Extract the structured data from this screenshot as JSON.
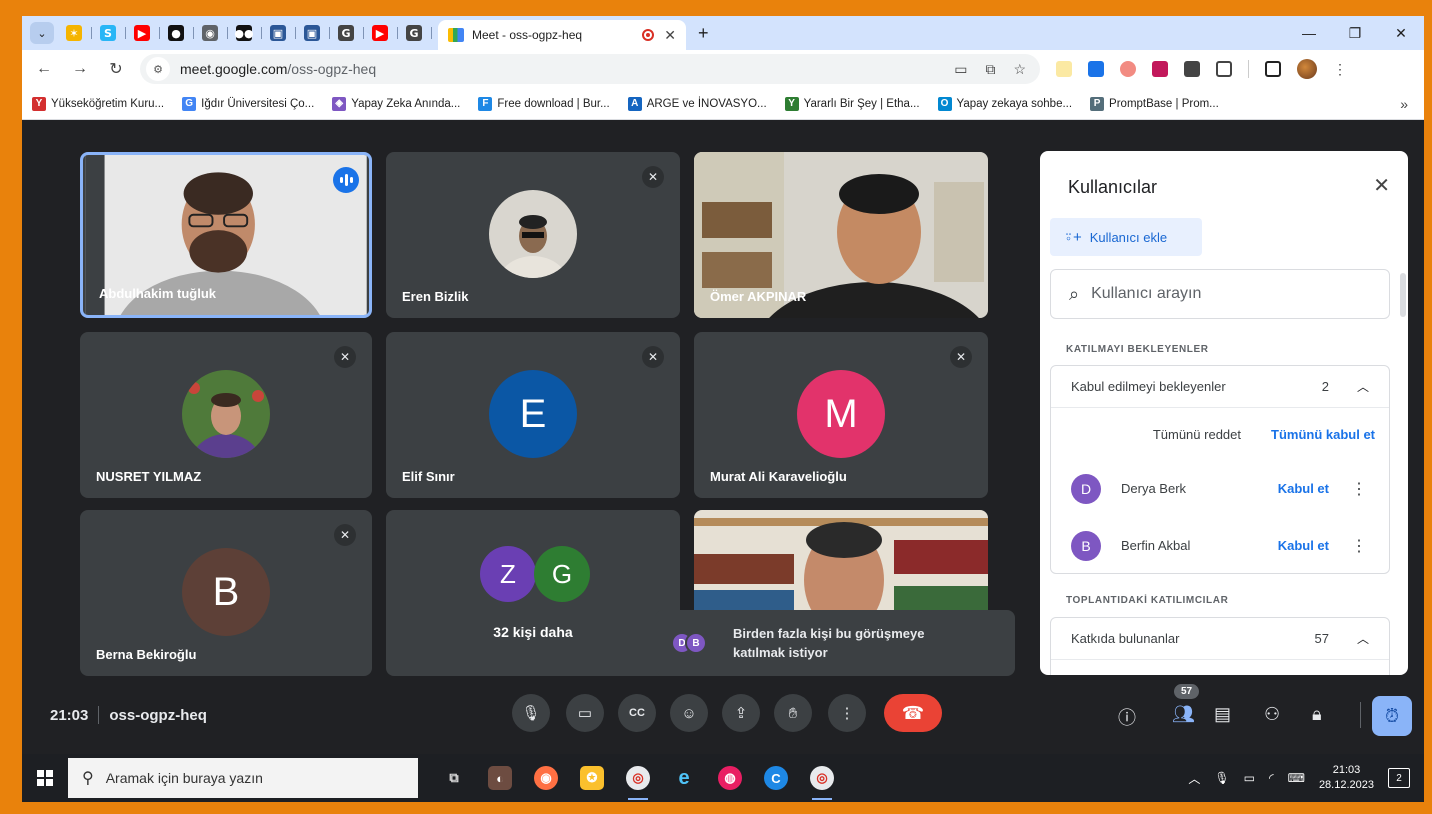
{
  "browser": {
    "pinned_tabs": [
      {
        "icon": "yellow-star-icon",
        "color": "#f5b400",
        "glyph": "✶"
      },
      {
        "icon": "s-icon",
        "color": "#29b6f6",
        "glyph": "S"
      },
      {
        "icon": "youtube-icon",
        "color": "#ff0000",
        "glyph": "▶"
      },
      {
        "icon": "circle-play-icon",
        "color": "#111111",
        "glyph": "●"
      },
      {
        "icon": "gray-circle-icon",
        "color": "#5f6368",
        "glyph": "◉"
      },
      {
        "icon": "medium-icon",
        "color": "#111111",
        "glyph": "●●"
      },
      {
        "icon": "app-icon-1",
        "color": "#2b5797",
        "glyph": "▣"
      },
      {
        "icon": "app-icon-2",
        "color": "#2b5797",
        "glyph": "▣"
      },
      {
        "icon": "google-icon",
        "color": "#444444",
        "glyph": "G"
      },
      {
        "icon": "youtube-icon",
        "color": "#ff0000",
        "glyph": "▶"
      },
      {
        "icon": "google-icon",
        "color": "#444444",
        "glyph": "G"
      }
    ],
    "active_tab_title": "Meet - oss-ogpz-heq",
    "new_tab": "+",
    "url_host": "meet.google.com",
    "url_path": "/oss-ogpz-heq"
  },
  "bookmarks": [
    {
      "label": "Yükseköğretim Kuru...",
      "color": "#d32f2f",
      "glyph": "Y"
    },
    {
      "label": "Iğdır Üniversitesi Ço...",
      "color": "#4285f4",
      "glyph": "G"
    },
    {
      "label": "Yapay Zeka Anında...",
      "color": "#7e57c2",
      "glyph": "◈"
    },
    {
      "label": "Free download | Bur...",
      "color": "#1e88e5",
      "glyph": "F"
    },
    {
      "label": "ARGE ve İNOVASYO...",
      "color": "#1565c0",
      "glyph": "A"
    },
    {
      "label": "Yararlı Bir Şey | Etha...",
      "color": "#2e7d32",
      "glyph": "Y"
    },
    {
      "label": "Yapay zekaya sohbe...",
      "color": "#0288d1",
      "glyph": "O"
    },
    {
      "label": "PromptBase | Prom...",
      "color": "#546e7a",
      "glyph": "P"
    }
  ],
  "bookmarks_more": "»",
  "tiles": [
    {
      "name": "Abdulhakim tuğluk",
      "type": "video",
      "speaking": true
    },
    {
      "name": "Eren Bizlik",
      "type": "photo",
      "muted": true
    },
    {
      "name": "Ömer AKPINAR",
      "type": "video"
    },
    {
      "name": "NUSRET YILMAZ",
      "type": "photo",
      "muted": true
    },
    {
      "name": "Elif Sınır",
      "type": "letter",
      "letter": "E",
      "color": "#0b57a5",
      "muted": true
    },
    {
      "name": "Murat Ali Karavelioğlu",
      "type": "letter",
      "letter": "M",
      "color": "#e2336b",
      "muted": true
    },
    {
      "name": "Berna Bekiroğlu",
      "type": "letter",
      "letter": "B",
      "color": "#5d4037",
      "muted": true
    },
    {
      "name": "32 kişi daha",
      "type": "group",
      "letters": [
        "Z",
        "G"
      ],
      "colors": [
        "#6a3fb3",
        "#2e7d32"
      ]
    },
    {
      "name": "",
      "type": "video"
    }
  ],
  "panel": {
    "title": "Kullanıcılar",
    "add_label": "Kullanıcı ekle",
    "search_placeholder": "Kullanıcı arayın",
    "waiting_section": "KATILMAYI BEKLEYENLER",
    "waiting_group": {
      "label": "Kabul edilmeyi bekleyenler",
      "count": "2"
    },
    "deny_all": "Tümünü reddet",
    "accept_all": "Tümünü kabul et",
    "waiting": [
      {
        "initial": "D",
        "name": "Derya Berk",
        "action": "Kabul et"
      },
      {
        "initial": "B",
        "name": "Berfin Akbal",
        "action": "Kabul et"
      }
    ],
    "in_meeting_section": "TOPLANTIDAKİ KATILIMCILAR",
    "contributors": {
      "label": "Katkıda bulunanlar",
      "count": "57"
    }
  },
  "toast": {
    "initials": [
      "D",
      "B"
    ],
    "text": "Birden fazla kişi bu görüşmeye katılmak istiyor"
  },
  "bottom": {
    "time": "21:03",
    "code": "oss-ogpz-heq",
    "participant_badge": "57"
  },
  "taskbar": {
    "search_placeholder": "Aramak için buraya yazın",
    "clock_time": "21:03",
    "clock_date": "28.12.2023",
    "notifications": "2"
  }
}
